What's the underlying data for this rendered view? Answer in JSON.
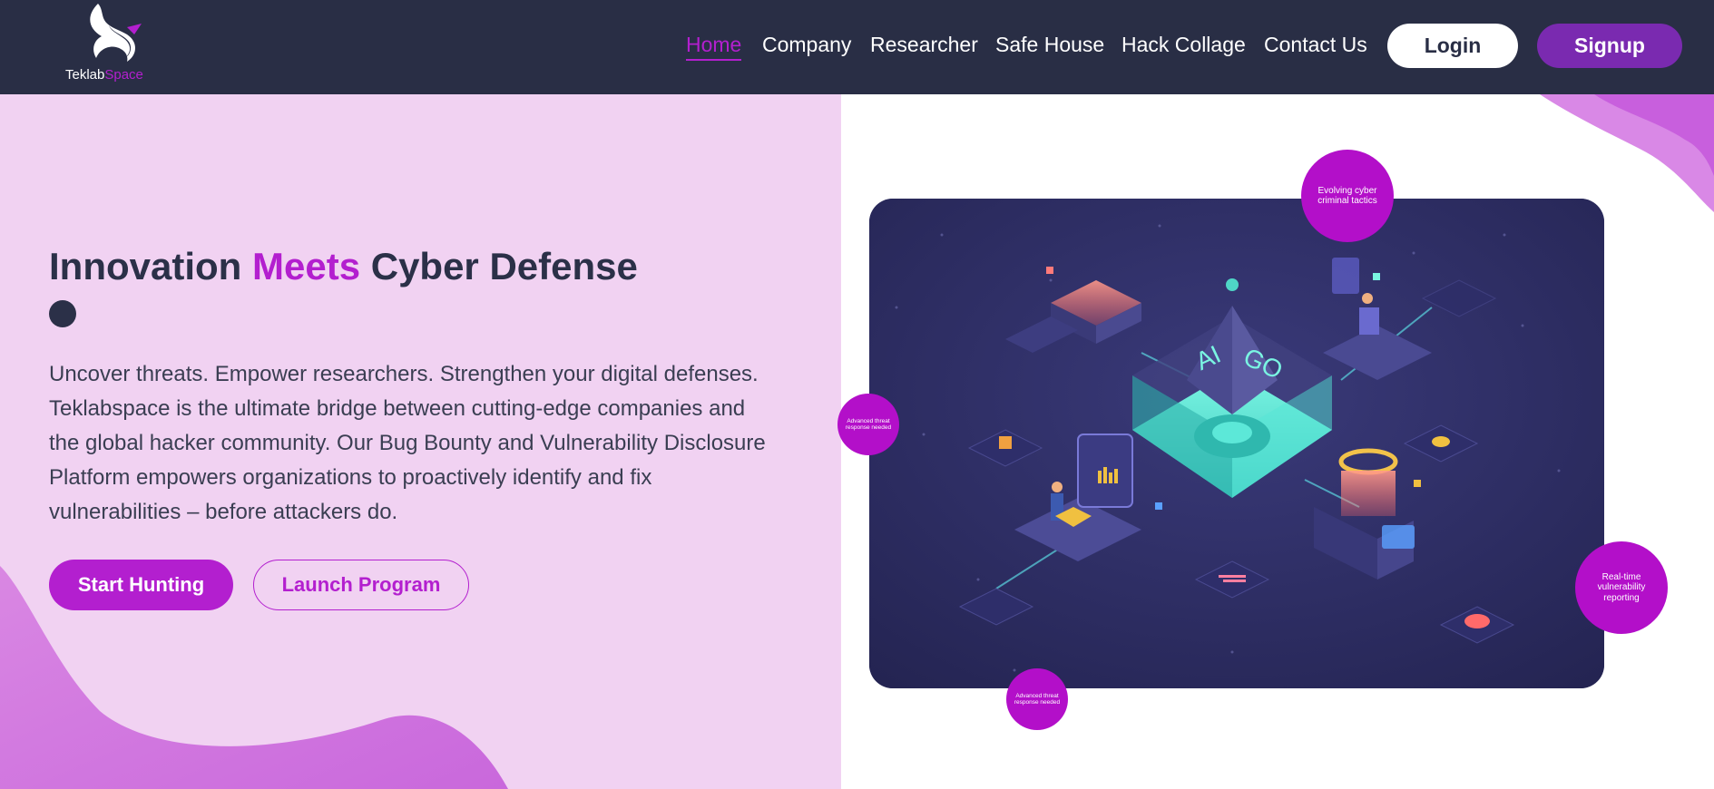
{
  "brand": {
    "name_main": "Teklab",
    "name_accent": "Space"
  },
  "nav": {
    "items": [
      {
        "label": "Home"
      },
      {
        "label": "Company"
      },
      {
        "label": "Researcher"
      },
      {
        "label": "Safe House"
      },
      {
        "label": "Hack Collage"
      },
      {
        "label": "Contact Us"
      }
    ],
    "login": "Login",
    "signup": "Signup"
  },
  "hero": {
    "title_part1": "Innovation ",
    "title_accent": "Meets",
    "title_part2": " Cyber Defense",
    "description": "Uncover threats. Empower researchers. Strengthen your digital defenses. Teklabspace is the ultimate bridge between cutting-edge companies and the global hacker community. Our Bug Bounty and Vulnerability Disclosure Platform empowers organizations to proactively identify and fix vulnerabilities – before attackers do.",
    "cta_primary": "Start Hunting",
    "cta_secondary": "Launch Program"
  },
  "illustration": {
    "pyramid_text_left": "AI",
    "pyramid_text_right": "GO"
  },
  "bubbles": [
    {
      "text": "Evolving cyber criminal tactics"
    },
    {
      "text": "Advanced threat response needed"
    },
    {
      "text": "Real-time vulnerability reporting"
    },
    {
      "text": "Advanced threat response needed"
    }
  ],
  "colors": {
    "nav_bg": "#292e45",
    "accent": "#b31fcf",
    "signup_bg": "#7a2ab0",
    "hero_left_bg": "#f1d2f2",
    "bubble": "#b30fc9",
    "illustration_bg": "#2c2c61"
  }
}
